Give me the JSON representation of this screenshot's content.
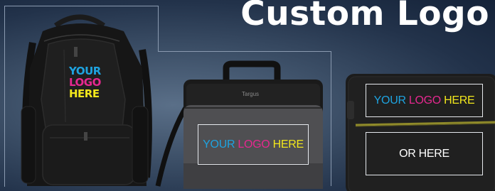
{
  "banner": {
    "title": "Custom Logo",
    "backpack_logo": {
      "line1": "YOUR",
      "line2": "LOGO",
      "line3": "HERE"
    },
    "briefcase_logo": {
      "word1": "YOUR",
      "word2": "LOGO",
      "word3": "HERE"
    },
    "sleeve_logo": {
      "word1": "YOUR",
      "word2": "LOGO",
      "word3": "HERE"
    },
    "alt_placement": "OR HERE",
    "brand_mark": "Targus"
  },
  "colors": {
    "cyan": "#1ea3e0",
    "magenta": "#e5288f",
    "yellow": "#f2e71c",
    "background": "#2c3e56"
  },
  "icons": [
    "backpack-image",
    "laptop-case-image",
    "laptop-sleeve-image"
  ]
}
